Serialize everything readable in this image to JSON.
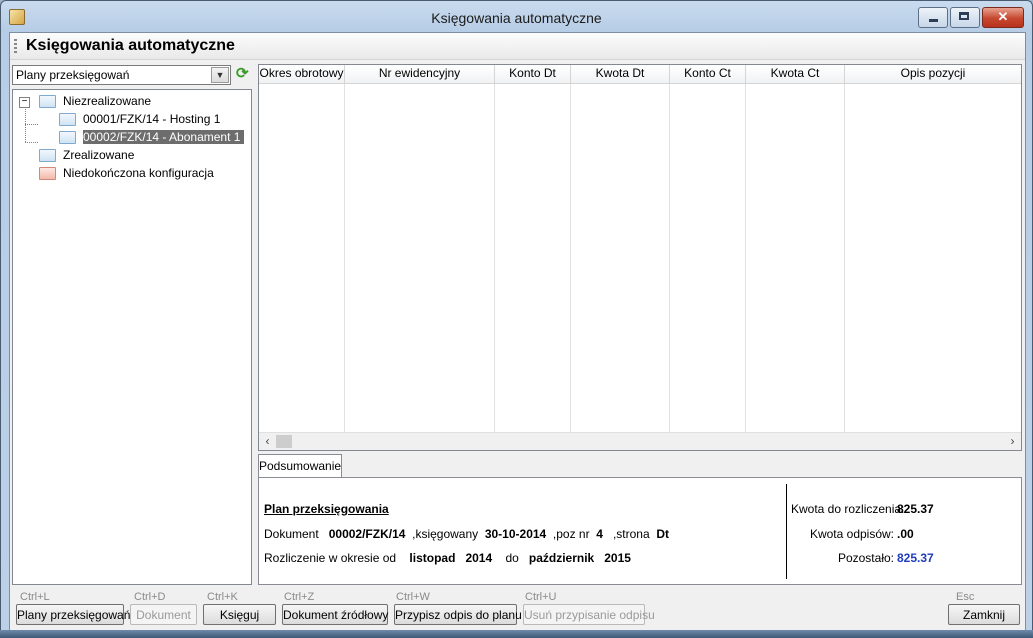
{
  "window": {
    "title": "Księgowania automatyczne",
    "controls": {
      "minimize": "minimize",
      "maximize": "maximize",
      "close": "✕"
    }
  },
  "header": {
    "title": "Księgowania automatyczne"
  },
  "filter": {
    "selected": "Plany przeksięgowań"
  },
  "tree": {
    "groups": [
      {
        "label": "Niezrealizowane",
        "expanded": true,
        "icon": "folder-icon",
        "children": [
          {
            "label": "00001/FZK/14 - Hosting 1",
            "selected": false
          },
          {
            "label": "00002/FZK/14 - Abonament 1",
            "selected": true
          }
        ]
      },
      {
        "label": "Zrealizowane",
        "icon": "folder-icon"
      },
      {
        "label": "Niedokończona konfiguracja",
        "icon": "folder-red-icon"
      }
    ]
  },
  "grid": {
    "columns": [
      "Okres obrotowy",
      "Nr ewidencyjny",
      "Konto Dt",
      "Kwota Dt",
      "Konto Ct",
      "Kwota Ct",
      "Opis pozycji"
    ],
    "rows": []
  },
  "tabs": [
    {
      "label": "Podsumowanie",
      "active": true
    }
  ],
  "summary": {
    "title": "Plan przeksięgowania",
    "document_label": "Dokument",
    "document_value": "00002/FZK/14",
    "posted_label": ",księgowany",
    "posted_value": "30-10-2014",
    "pos_label": ",poz nr",
    "pos_value": "4",
    "side_label": ",strona",
    "side_value": "Dt",
    "period_label": "Rozliczenie w okresie od",
    "from_month": "listopad",
    "from_year": "2014",
    "to_label": "do",
    "to_month": "październik",
    "to_year": "2015",
    "amount_label": "Kwota do rozliczenia:",
    "amount_value": "825.37",
    "writeoff_label": "Kwota odpisów:",
    "writeoff_value": ".00",
    "remaining_label": "Pozostało:",
    "remaining_value": "825.37"
  },
  "toolbar": {
    "plans": {
      "shortcut": "Ctrl+L",
      "label": "Plany przeksięgowań",
      "enabled": true
    },
    "document": {
      "shortcut": "Ctrl+D",
      "label": "Dokument",
      "enabled": false
    },
    "post": {
      "shortcut": "Ctrl+K",
      "label": "Księguj",
      "enabled": true
    },
    "source": {
      "shortcut": "Ctrl+Z",
      "label": "Dokument źródłowy",
      "enabled": true
    },
    "assign": {
      "shortcut": "Ctrl+W",
      "label": "Przypisz odpis do planu",
      "enabled": true
    },
    "unassign": {
      "shortcut": "Ctrl+U",
      "label": "Usuń przypisanie odpisu",
      "enabled": false
    },
    "close": {
      "shortcut": "Esc",
      "label": "Zamknij",
      "enabled": true
    }
  },
  "colors": {
    "selection": "#6d6d6d",
    "remaining_value": "#1f3bbf",
    "close_button": "#c6472f"
  }
}
